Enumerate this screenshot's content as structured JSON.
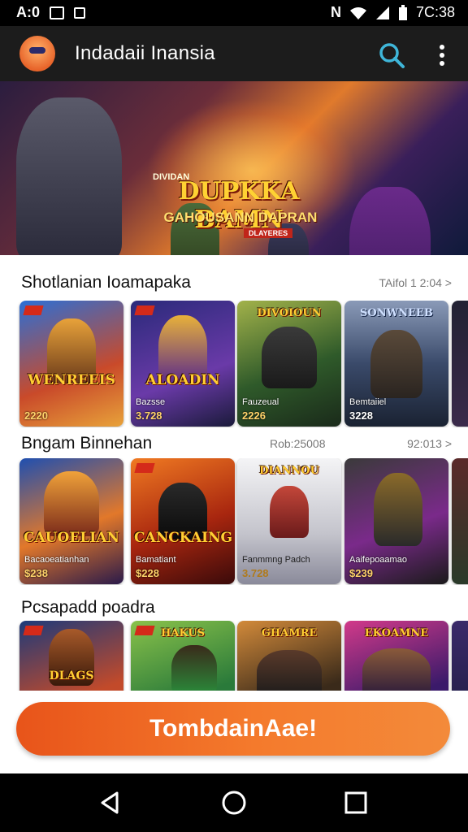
{
  "status_bar": {
    "time_left": "A:0",
    "time_right": "7C:38",
    "icons": [
      "image-icon",
      "notification-icon",
      "nfc-icon",
      "wifi-icon",
      "signal-icon",
      "battery-icon"
    ]
  },
  "app_bar": {
    "title": "Indadaii Inansia",
    "icons": [
      "avatar-icon",
      "search-icon",
      "more-vert-icon"
    ]
  },
  "banner": {
    "top_small": "DIVIDAN",
    "title": "DUPKKA BAMN",
    "subtitle": "GAHOUSANN DAPRAN",
    "tag": "DLAYERES"
  },
  "sections": [
    {
      "title": "Shotlanian Ioamapaka",
      "meta": "TAifol 1 2:04 >",
      "cards": [
        {
          "logo": "WENREEIS",
          "subtitle": "",
          "price": "2220",
          "colors": [
            "#2b6fd6",
            "#e8a23a"
          ]
        },
        {
          "logo": "ALOADIN",
          "subtitle": "Bazsse",
          "price": "3.728",
          "colors": [
            "#2a2a7a",
            "#6a3aa8"
          ]
        },
        {
          "logo": "DIVOIOUN",
          "subtitle": "Fauzeual",
          "price": "2226",
          "colors": [
            "#2f5a2a",
            "#a2b24a"
          ]
        },
        {
          "logo": "SONWNEEB",
          "subtitle": "Bemtaiiel",
          "price": "3228",
          "colors": [
            "#3a4a6a",
            "#8a9ab8"
          ]
        }
      ]
    },
    {
      "title": "Bngam Binnehan",
      "meta_mid": "Rob:25008",
      "meta": "92:013 >",
      "cards": [
        {
          "logo": "CAUOELIAN",
          "subtitle": "Bacaoeatianhan",
          "price": "$238",
          "colors": [
            "#1f4fb0",
            "#e2782a"
          ]
        },
        {
          "logo": "CANCKAING",
          "subtitle": "Bamatiant",
          "price": "$228",
          "colors": [
            "#a8260f",
            "#f07a22"
          ]
        },
        {
          "logo": "DIANNOU",
          "subtitle": "Fanmmng Padch",
          "price": "3.728",
          "colors": [
            "#e6e6ea",
            "#c4473a"
          ]
        },
        {
          "logo": "",
          "subtitle": "Aaifepoaamao",
          "price": "$239",
          "colors": [
            "#3a3a3a",
            "#7a2a8a"
          ]
        }
      ]
    },
    {
      "title": "Pcsapadd poadra",
      "cards": [
        {
          "logo": "DLAGS",
          "colors": [
            "#1d3a7a",
            "#c24a2a"
          ]
        },
        {
          "logo": "HAKUS",
          "colors": [
            "#2a7a3a",
            "#8ac24a"
          ]
        },
        {
          "logo": "GHAMRE",
          "colors": [
            "#3a2a1a",
            "#d28a3a"
          ]
        },
        {
          "logo": "EKOAMNE",
          "colors": [
            "#3a1a6a",
            "#d23a8a"
          ]
        }
      ]
    }
  ],
  "cta": {
    "label": "TombdainAae!"
  },
  "nav_bar": {
    "icons": [
      "back-icon",
      "home-icon",
      "recents-icon"
    ]
  }
}
